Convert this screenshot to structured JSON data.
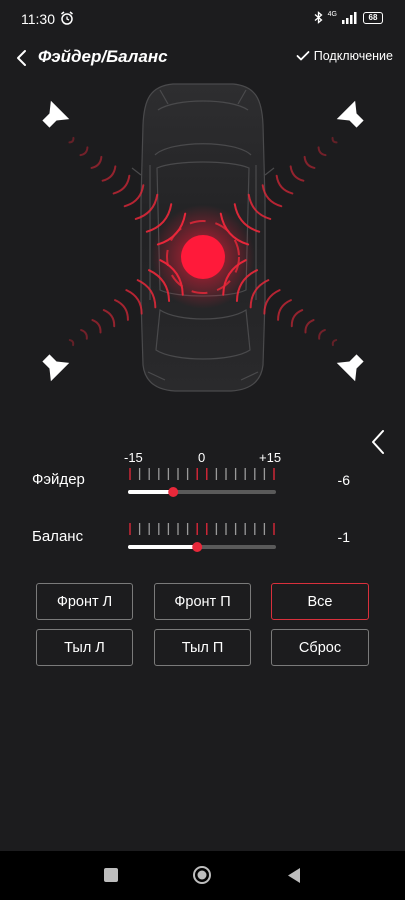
{
  "status_bar": {
    "time": "11:30",
    "network": "4G",
    "battery": "68"
  },
  "header": {
    "title": "Фэйдер/Баланс",
    "connect_label": "Подключение"
  },
  "scale": {
    "min_label": "-15",
    "mid_label": "0",
    "max_label": "+15",
    "min": -15,
    "max": 15
  },
  "fader": {
    "label": "Фэйдер",
    "value": -6,
    "value_text": "-6"
  },
  "balance": {
    "label": "Баланс",
    "value": -1,
    "value_text": "-1"
  },
  "buttons": [
    {
      "id": "front-left",
      "label": "Фронт Л",
      "active": false
    },
    {
      "id": "front-right",
      "label": "Фронт П",
      "active": false
    },
    {
      "id": "all",
      "label": "Все",
      "active": true
    },
    {
      "id": "rear-left",
      "label": "Тыл Л",
      "active": false
    },
    {
      "id": "rear-right",
      "label": "Тыл П",
      "active": false
    },
    {
      "id": "reset",
      "label": "Сброс",
      "active": false
    }
  ],
  "colors": {
    "accent": "#e8283a",
    "background": "#1c1c1e",
    "track": "#5a5a5a",
    "fill": "#ffffff"
  },
  "icons": [
    "alarm-icon",
    "bluetooth-icon",
    "signal-icon",
    "battery-icon",
    "back-icon",
    "check-icon",
    "speaker-icon",
    "chevron-left-icon"
  ]
}
